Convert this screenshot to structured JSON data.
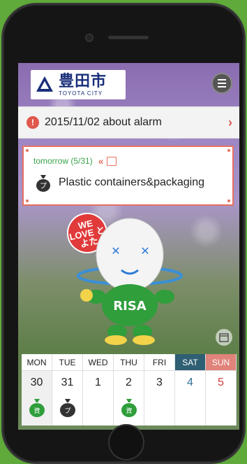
{
  "app": {
    "logo_jp": "豊田市",
    "logo_en": "TOYOTA CITY"
  },
  "alarm": {
    "text": "2015/11/02 about alarm"
  },
  "notice": {
    "day": "tomorrow (5/31)",
    "item": "Plastic containers&packaging"
  },
  "mascot": {
    "badge": "WE LOVE とよた",
    "shirt": "RISA"
  },
  "calendar": {
    "days": [
      "MON",
      "TUE",
      "WED",
      "THU",
      "FRI",
      "SAT",
      "SUN"
    ],
    "dates": [
      "30",
      "31",
      "1",
      "2",
      "3",
      "4",
      "5"
    ],
    "icons": [
      "resource-bag-icon",
      "plastic-bag-icon",
      "",
      "resource-bag-icon",
      "",
      "",
      ""
    ]
  },
  "colors": {
    "accent_red": "#e77062",
    "sat": "#2e5f73",
    "sun": "#e0837a",
    "green": "#3aa44b"
  }
}
